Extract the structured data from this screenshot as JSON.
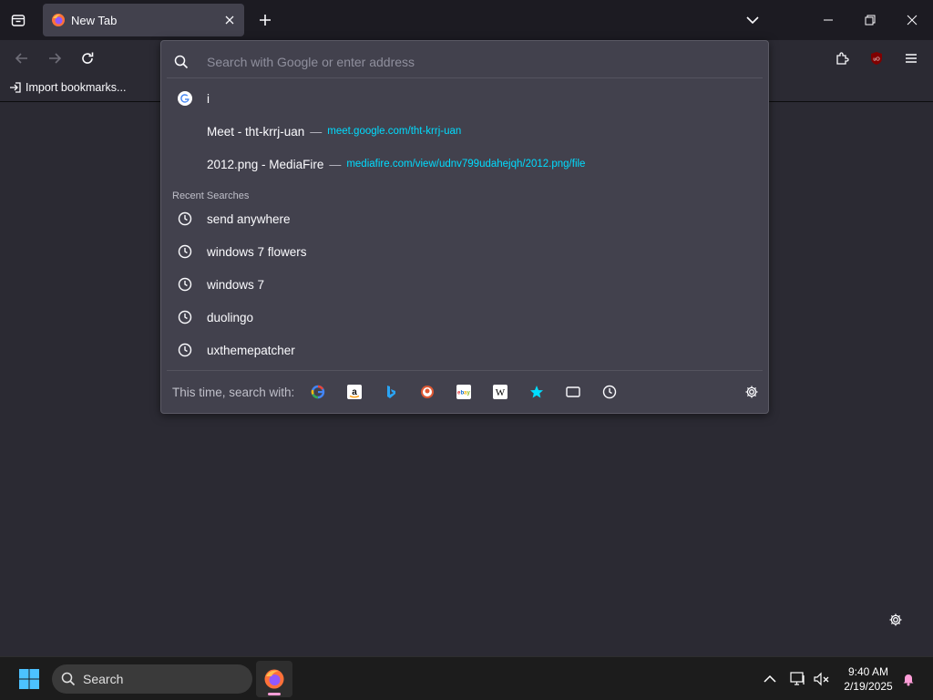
{
  "tab": {
    "title": "New Tab"
  },
  "bookmarks": {
    "import_label": "Import bookmarks..."
  },
  "urlbar": {
    "placeholder": "Search with Google or enter address",
    "typed_suggestion": "i",
    "suggestions": [
      {
        "title": "Meet - tht-krrj-uan",
        "url": "meet.google.com/tht-krrj-uan"
      },
      {
        "title": "2012.png - MediaFire",
        "url": "mediafire.com/view/udnv799udahejqh/2012.png/file"
      }
    ],
    "separator": "—",
    "recent_header": "Recent Searches",
    "recent": [
      "send anywhere",
      "windows 7 flowers",
      "windows 7",
      "duolingo",
      "uxthemepatcher"
    ],
    "oneoff_label": "This time, search with:",
    "engines": [
      "google-icon",
      "amazon-icon",
      "bing-icon",
      "duckduckgo-icon",
      "ebay-icon",
      "wikipedia-icon",
      "bookmarks-star-icon",
      "tabs-icon",
      "history-icon"
    ]
  },
  "taskbar": {
    "search_label": "Search",
    "time": "9:40 AM",
    "date": "2/19/2025"
  },
  "colors": {
    "tabstrip_bg": "#1c1b22",
    "toolbar_bg": "#2b2a33",
    "panel_bg": "#42414d",
    "url_color": "#00ddff",
    "taskbar_bg": "#1c1c1c"
  }
}
